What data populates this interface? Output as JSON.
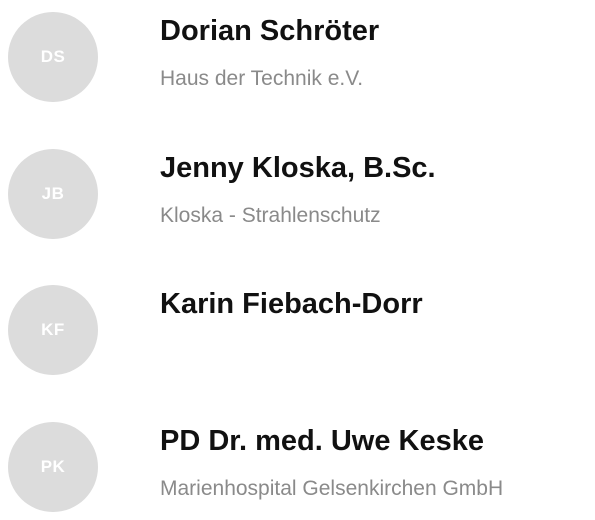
{
  "contacts": [
    {
      "initials": "DS",
      "name": "Dorian Schröter",
      "organization": "Haus der Technik e.V."
    },
    {
      "initials": "JB",
      "name": "Jenny Kloska, B.Sc.",
      "organization": "Kloska - Strahlenschutz"
    },
    {
      "initials": "KF",
      "name": "Karin Fiebach-Dorr",
      "organization": ""
    },
    {
      "initials": "PK",
      "name": "PD Dr. med. Uwe Keske",
      "organization": "Marienhospital Gelsenkirchen GmbH"
    }
  ],
  "colors": {
    "avatar_background": "#dcdcdc",
    "avatar_text": "#ffffff",
    "name_text": "#111111",
    "organization_text": "#8a8a8a"
  }
}
